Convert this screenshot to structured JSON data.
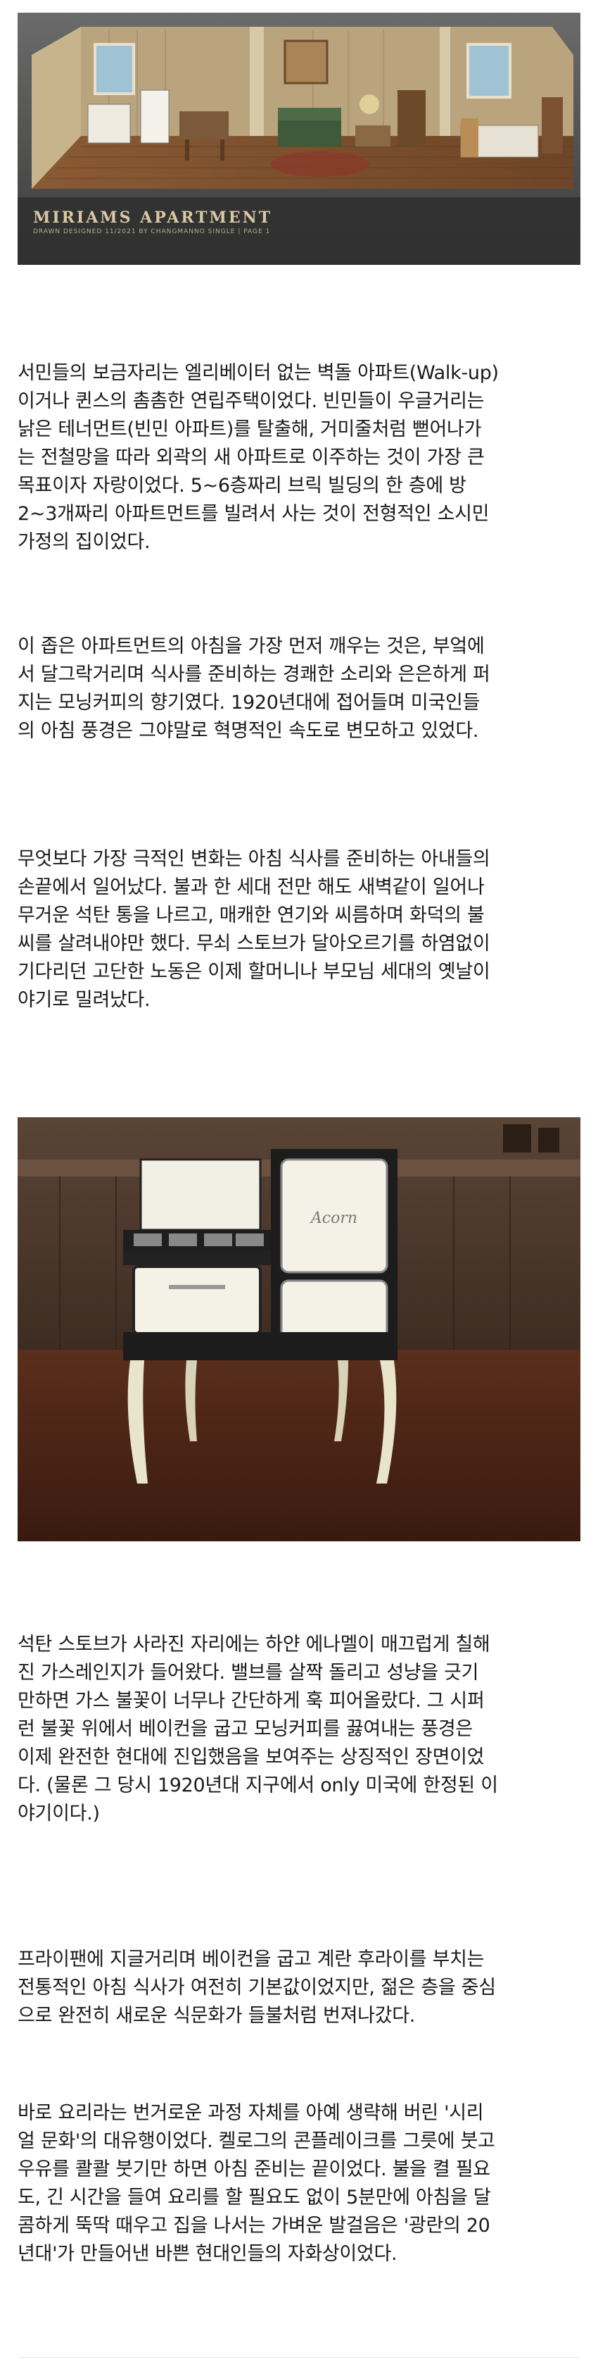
{
  "images": [
    {
      "kind": "illustration",
      "caption_title": "MIRIAMS APARTMENT",
      "caption_sub": "DRAWN DESIGNED 11/2021 BY CHANGMANNO SINGLE | PAGE 1"
    },
    {
      "kind": "photo",
      "brand_text": "Acorn"
    }
  ],
  "paragraphs": [
    "서민들의 보금자리는 엘리베이터 없는 벽돌 아파트(Walk-up)\n이거나 퀸스의 촘촘한 연립주택이었다. 빈민들이 우글거리는\n낡은 테너먼트(빈민 아파트)를 탈출해, 거미줄처럼 뻗어나가\n는 전철망을 따라 외곽의 새 아파트로 이주하는 것이 가장 큰\n목표이자 자랑이었다. 5~6층짜리 브릭 빌딩의 한 층에 방\n2~3개짜리 아파트먼트를 빌려서 사는 것이 전형적인 소시민\n가정의 집이었다.",
    "이 좁은 아파트먼트의 아침을 가장 먼저 깨우는 것은, 부엌에\n서 달그락거리며 식사를 준비하는 경쾌한 소리와 은은하게 퍼\n지는 모닝커피의 향기였다. 1920년대에 접어들며 미국인들\n의 아침 풍경은 그야말로 혁명적인 속도로 변모하고 있었다.",
    "무엇보다 가장 극적인 변화는 아침 식사를 준비하는 아내들의\n손끝에서 일어났다. 불과 한 세대 전만 해도 새벽같이 일어나\n무거운 석탄 통을 나르고, 매캐한 연기와 씨름하며 화덕의 불\n씨를 살려내야만 했다. 무쇠 스토브가 달아오르기를 하염없이\n기다리던 고단한 노동은 이제 할머니나 부모님 세대의 옛날이\n야기로 밀려났다.",
    "석탄 스토브가 사라진 자리에는 하얀 에나멜이 매끄럽게 칠해\n진 가스레인지가 들어왔다. 밸브를 살짝 돌리고 성냥을 긋기\n만하면 가스 불꽃이 너무나 간단하게 훅 피어올랐다. 그 시퍼\n런 불꽃 위에서 베이컨을 굽고 모닝커피를 끓여내는 풍경은\n이제 완전한 현대에 진입했음을 보여주는 상징적인 장면이었\n다. (물론 그 당시 1920년대 지구에서 only 미국에 한정된 이\n야기이다.)",
    "프라이팬에 지글거리며 베이컨을 굽고 계란 후라이를 부치는\n전통적인 아침 식사가 여전히 기본값이었지만, 젊은 층을 중심\n으로 완전히 새로운 식문화가 들불처럼 번져나갔다.",
    "바로 요리라는 번거로운 과정 자체를 아예 생략해 버린 '시리\n얼 문화'의 대유행이었다. 켈로그의 콘플레이크를 그릇에 붓고\n우유를 콸콸 붓기만 하면 아침 준비는 끝이었다. 불을 켤 필요\n도, 긴 시간을 들여 요리를 할 필요도 없이 5분만에 아침을 달\n콤하게 뚝딱 때우고 집을 나서는 가벼운 발걸음은 '광란의 20\n년대'가 만들어낸 바쁜 현대인들의 자화상이었다."
  ]
}
